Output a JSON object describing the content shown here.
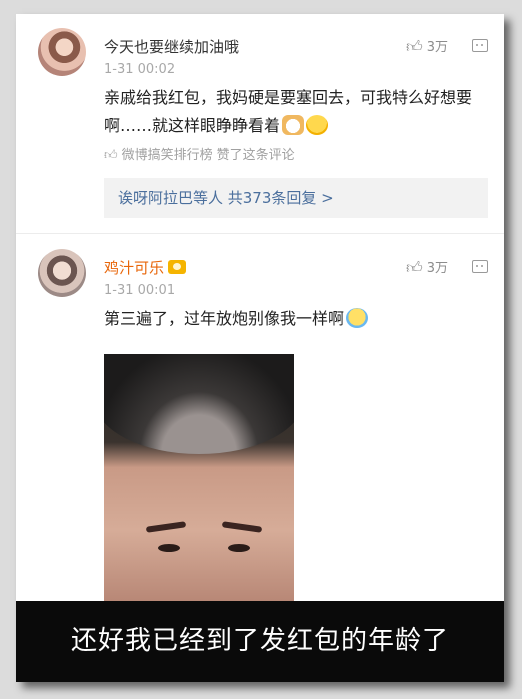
{
  "comments": [
    {
      "username": "今天也要继续加油哦",
      "time": "1-31 00:02",
      "likes": "3万",
      "text": "亲戚给我红包，我妈硬是要塞回去，可我特么好想要啊……就这样眼睁睁看着",
      "emojis": [
        "cat-emoji-icon",
        "face-emoji-icon"
      ],
      "source_account": "微博搞笑排行榜",
      "source_action": "赞了这条评论",
      "more_replies": "诶呀阿拉巴等人  共373条回复 >"
    },
    {
      "username": "鸡汁可乐",
      "time": "1-31 00:01",
      "likes": "3万",
      "text": "第三遍了，过年放炮别像我一样啊",
      "emojis": [
        "crying-emoji-icon"
      ],
      "photo": "burnt-hair-photo"
    }
  ],
  "caption": "还好我已经到了发红包的年龄了",
  "colors": {
    "vip_name": "#e8660a",
    "link_blue": "#4b6f9d",
    "caption_bg": "#0a0a0a"
  }
}
